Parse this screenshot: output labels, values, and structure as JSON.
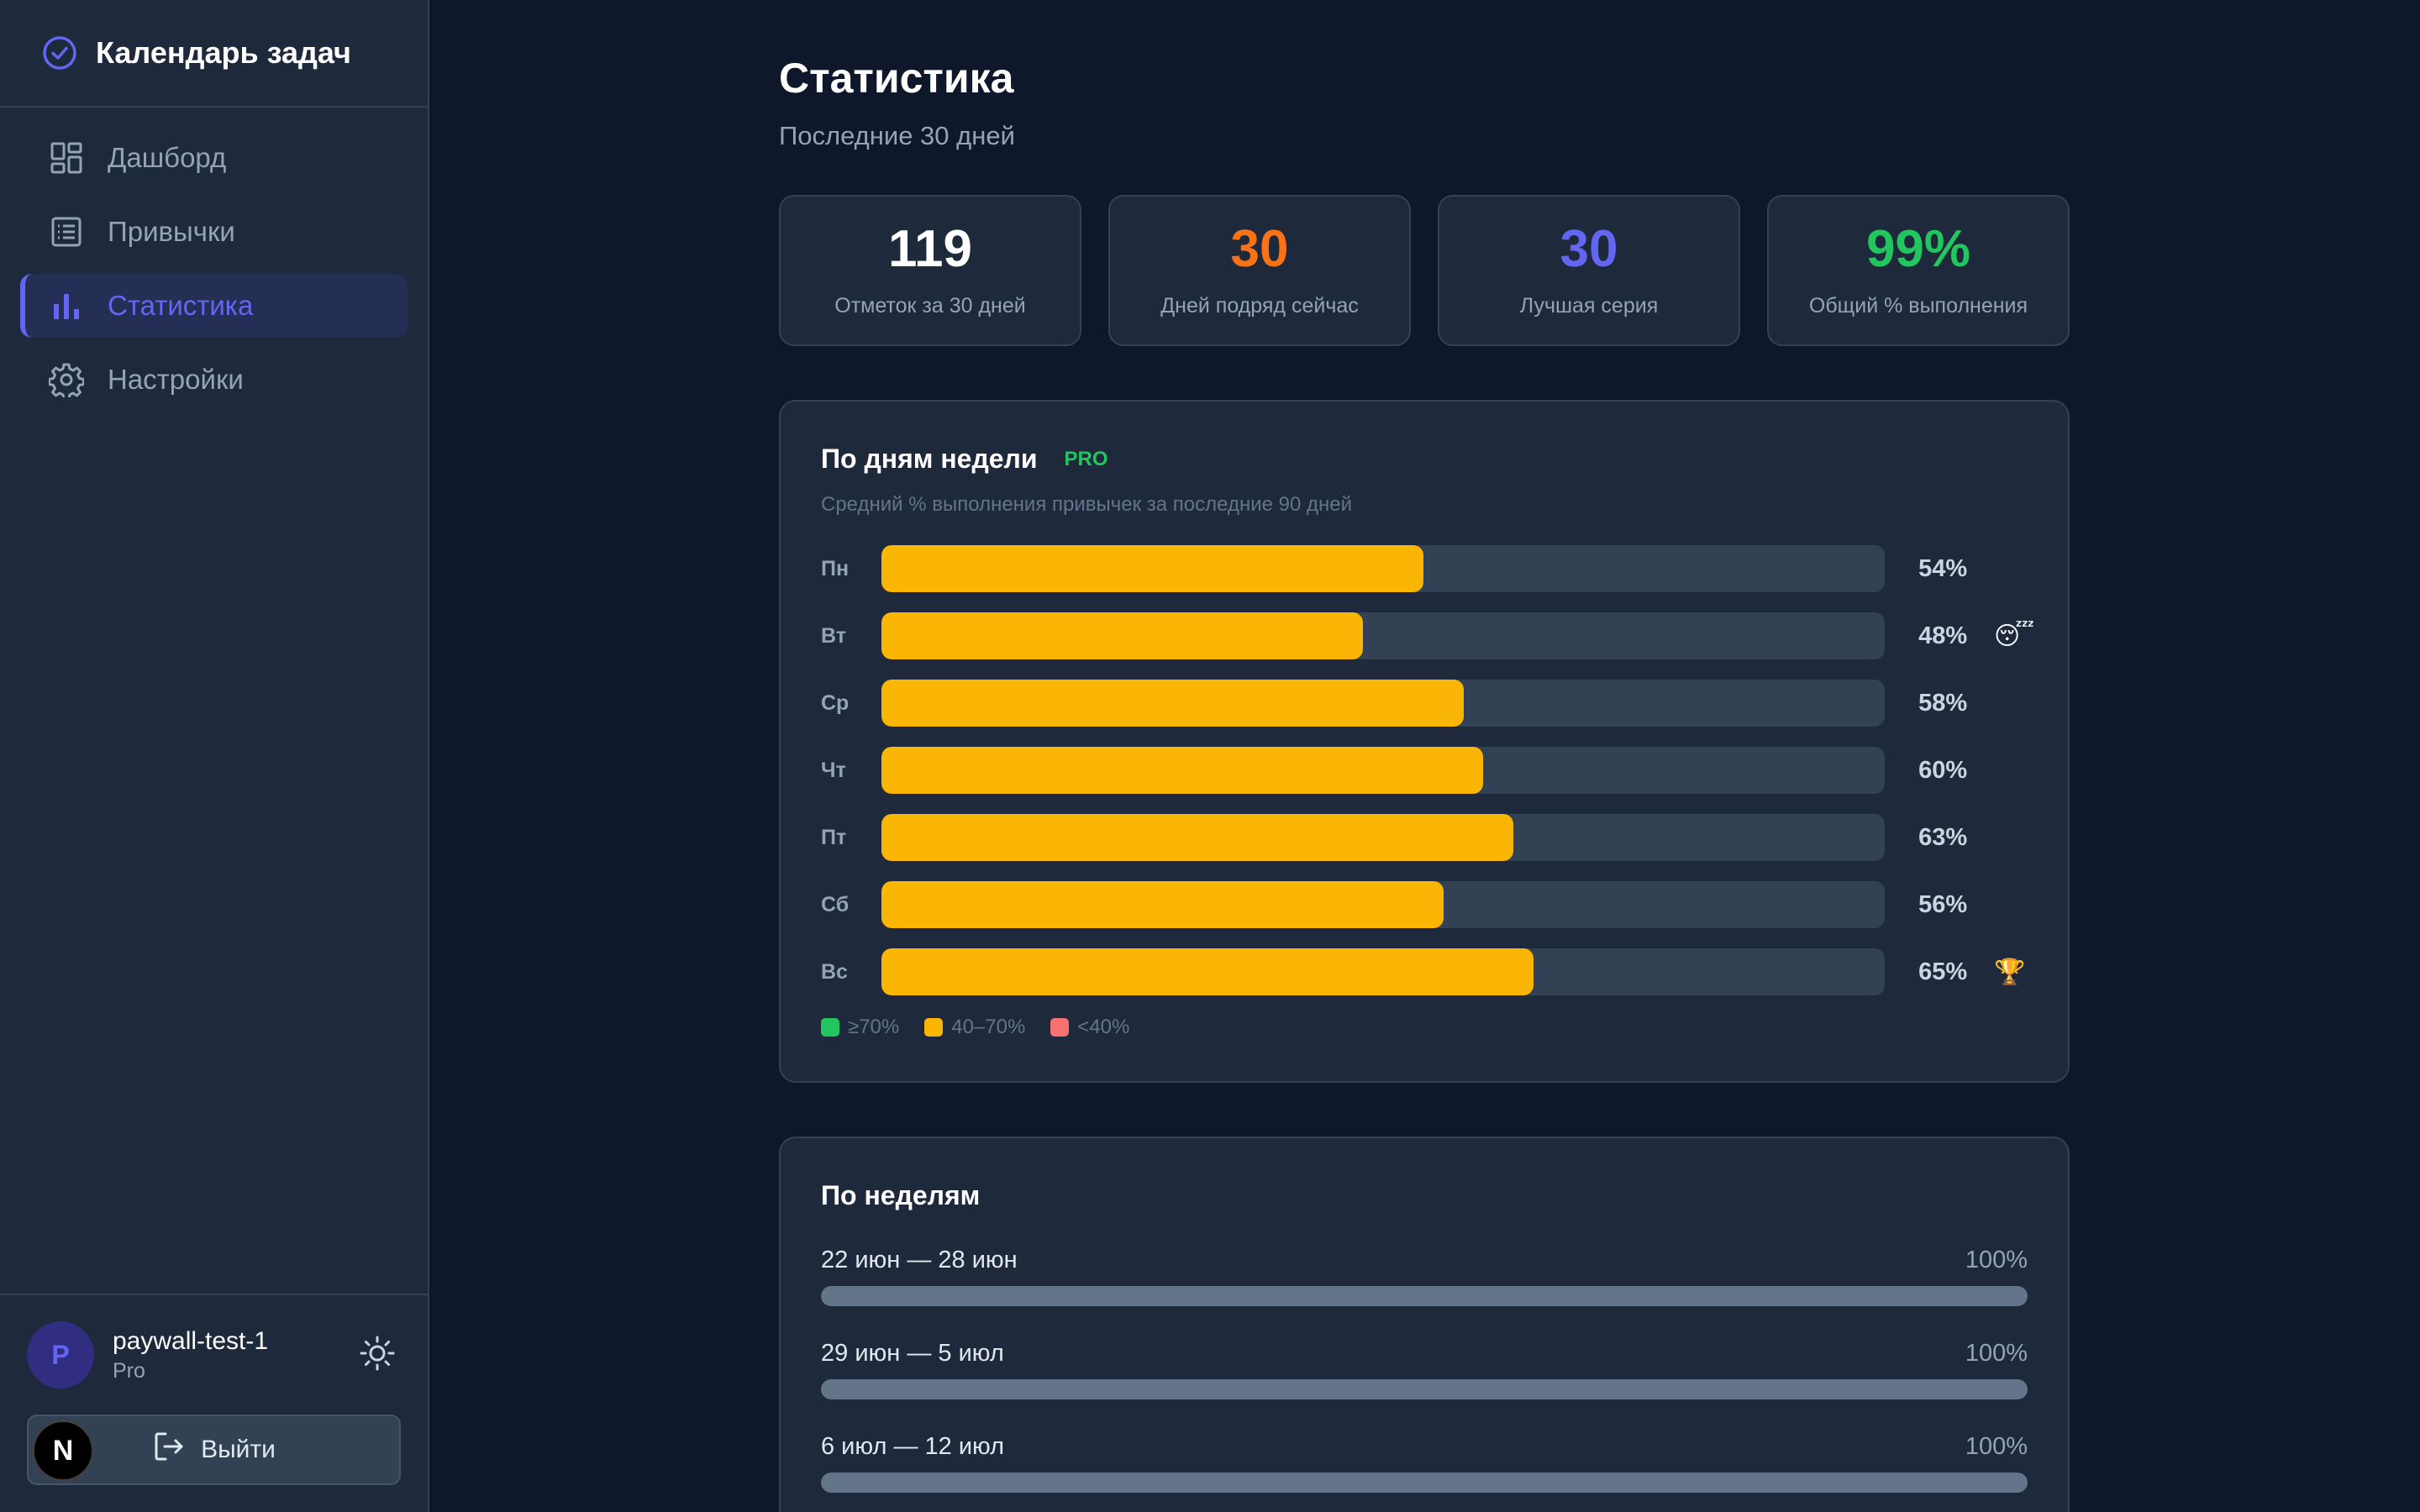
{
  "app": {
    "title": "Календарь задач",
    "accent": "#6366f1"
  },
  "nav": [
    {
      "label": "Дашборд",
      "icon": "dashboard-icon",
      "active": false
    },
    {
      "label": "Привычки",
      "icon": "list-icon",
      "active": false
    },
    {
      "label": "Статистика",
      "icon": "bar-chart-icon",
      "active": true
    },
    {
      "label": "Настройки",
      "icon": "gear-icon",
      "active": false
    }
  ],
  "user": {
    "initial": "P",
    "name": "paywall-test-1",
    "plan": "Pro"
  },
  "logout": {
    "label": "Выйти",
    "badge": "N"
  },
  "page": {
    "title": "Статистика",
    "subtitle": "Последние 30 дней"
  },
  "stats": [
    {
      "value": "119",
      "label": "Отметок за 30 дней",
      "color": "#ffffff"
    },
    {
      "value": "30",
      "label": "Дней подряд сейчас",
      "color": "#f97316"
    },
    {
      "value": "30",
      "label": "Лучшая серия",
      "color": "#6366f1"
    },
    {
      "value": "99%",
      "label": "Общий % выполнения",
      "color": "#22c55e"
    }
  ],
  "weekday_card": {
    "title": "По дням недели",
    "badge": "PRO",
    "subtitle": "Средний % выполнения привычек за последние 90 дней",
    "fill_color": "#fbb505",
    "days": [
      {
        "day": "Пн",
        "value": 54,
        "label": "54%",
        "emoji": ""
      },
      {
        "day": "Вт",
        "value": 48,
        "label": "48%",
        "emoji": "😴"
      },
      {
        "day": "Ср",
        "value": 58,
        "label": "58%",
        "emoji": ""
      },
      {
        "day": "Чт",
        "value": 60,
        "label": "60%",
        "emoji": ""
      },
      {
        "day": "Пт",
        "value": 63,
        "label": "63%",
        "emoji": ""
      },
      {
        "day": "Сб",
        "value": 56,
        "label": "56%",
        "emoji": ""
      },
      {
        "day": "Вс",
        "value": 65,
        "label": "65%",
        "emoji": "🏆"
      }
    ],
    "legend": [
      {
        "label": "≥70%",
        "color": "#22c55e"
      },
      {
        "label": "40–70%",
        "color": "#fbb505"
      },
      {
        "label": "<40%",
        "color": "#f87171"
      }
    ]
  },
  "weeks_card": {
    "title": "По неделям",
    "weeks": [
      {
        "range": "22 июн — 28 июн",
        "value": 100,
        "label": "100%"
      },
      {
        "range": "29 июн — 5 июл",
        "value": 100,
        "label": "100%"
      },
      {
        "range": "6 июл — 12 июл",
        "value": 100,
        "label": "100%"
      }
    ]
  }
}
